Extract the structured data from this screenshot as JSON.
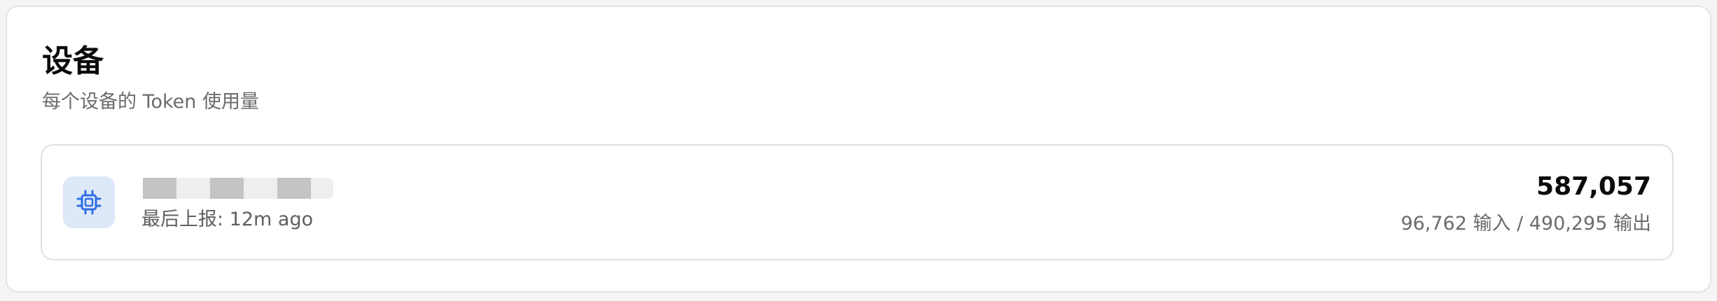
{
  "section": {
    "title": "设备",
    "subtitle": "每个设备的 Token 使用量"
  },
  "device": {
    "name": "",
    "last_report": "最后上报: 12m ago",
    "total": "587,057",
    "breakdown": "96,762 输入 / 490,295 输出",
    "icon": "chip-icon",
    "icon_color": "#2f6fe4",
    "icon_bg": "#dde8f9"
  }
}
